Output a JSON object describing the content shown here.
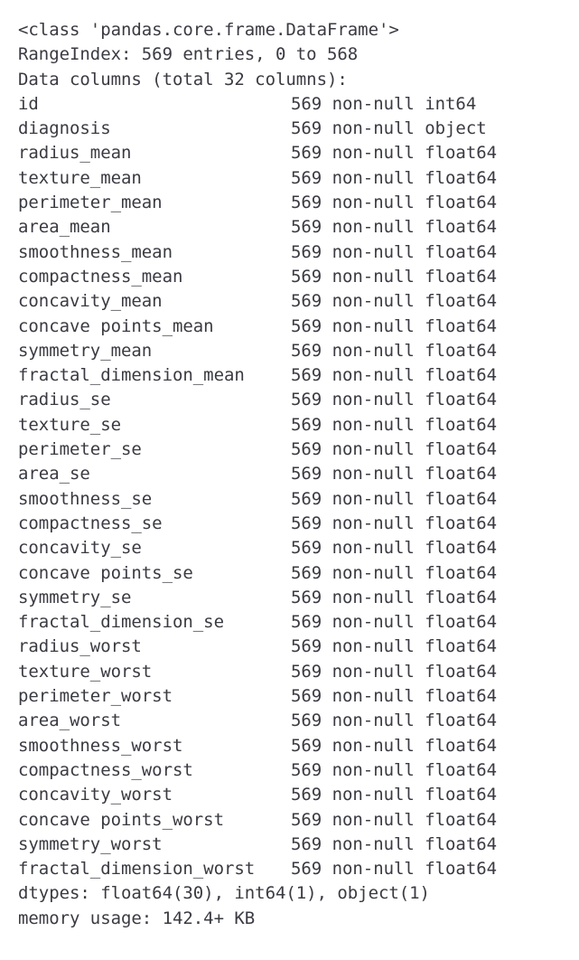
{
  "header": {
    "class_line": "<class 'pandas.core.frame.DataFrame'>",
    "index_line": "RangeIndex: 569 entries, 0 to 568",
    "columns_line": "Data columns (total 32 columns):"
  },
  "columns": [
    {
      "name": "id",
      "count": "569",
      "nonnull": "non-null",
      "dtype": "int64"
    },
    {
      "name": "diagnosis",
      "count": "569",
      "nonnull": "non-null",
      "dtype": "object"
    },
    {
      "name": "radius_mean",
      "count": "569",
      "nonnull": "non-null",
      "dtype": "float64"
    },
    {
      "name": "texture_mean",
      "count": "569",
      "nonnull": "non-null",
      "dtype": "float64"
    },
    {
      "name": "perimeter_mean",
      "count": "569",
      "nonnull": "non-null",
      "dtype": "float64"
    },
    {
      "name": "area_mean",
      "count": "569",
      "nonnull": "non-null",
      "dtype": "float64"
    },
    {
      "name": "smoothness_mean",
      "count": "569",
      "nonnull": "non-null",
      "dtype": "float64"
    },
    {
      "name": "compactness_mean",
      "count": "569",
      "nonnull": "non-null",
      "dtype": "float64"
    },
    {
      "name": "concavity_mean",
      "count": "569",
      "nonnull": "non-null",
      "dtype": "float64"
    },
    {
      "name": "concave points_mean",
      "count": "569",
      "nonnull": "non-null",
      "dtype": "float64"
    },
    {
      "name": "symmetry_mean",
      "count": "569",
      "nonnull": "non-null",
      "dtype": "float64"
    },
    {
      "name": "fractal_dimension_mean",
      "count": "569",
      "nonnull": "non-null",
      "dtype": "float64"
    },
    {
      "name": "radius_se",
      "count": "569",
      "nonnull": "non-null",
      "dtype": "float64"
    },
    {
      "name": "texture_se",
      "count": "569",
      "nonnull": "non-null",
      "dtype": "float64"
    },
    {
      "name": "perimeter_se",
      "count": "569",
      "nonnull": "non-null",
      "dtype": "float64"
    },
    {
      "name": "area_se",
      "count": "569",
      "nonnull": "non-null",
      "dtype": "float64"
    },
    {
      "name": "smoothness_se",
      "count": "569",
      "nonnull": "non-null",
      "dtype": "float64"
    },
    {
      "name": "compactness_se",
      "count": "569",
      "nonnull": "non-null",
      "dtype": "float64"
    },
    {
      "name": "concavity_se",
      "count": "569",
      "nonnull": "non-null",
      "dtype": "float64"
    },
    {
      "name": "concave points_se",
      "count": "569",
      "nonnull": "non-null",
      "dtype": "float64"
    },
    {
      "name": "symmetry_se",
      "count": "569",
      "nonnull": "non-null",
      "dtype": "float64"
    },
    {
      "name": "fractal_dimension_se",
      "count": "569",
      "nonnull": "non-null",
      "dtype": "float64"
    },
    {
      "name": "radius_worst",
      "count": "569",
      "nonnull": "non-null",
      "dtype": "float64"
    },
    {
      "name": "texture_worst",
      "count": "569",
      "nonnull": "non-null",
      "dtype": "float64"
    },
    {
      "name": "perimeter_worst",
      "count": "569",
      "nonnull": "non-null",
      "dtype": "float64"
    },
    {
      "name": "area_worst",
      "count": "569",
      "nonnull": "non-null",
      "dtype": "float64"
    },
    {
      "name": "smoothness_worst",
      "count": "569",
      "nonnull": "non-null",
      "dtype": "float64"
    },
    {
      "name": "compactness_worst",
      "count": "569",
      "nonnull": "non-null",
      "dtype": "float64"
    },
    {
      "name": "concavity_worst",
      "count": "569",
      "nonnull": "non-null",
      "dtype": "float64"
    },
    {
      "name": "concave points_worst",
      "count": "569",
      "nonnull": "non-null",
      "dtype": "float64"
    },
    {
      "name": "symmetry_worst",
      "count": "569",
      "nonnull": "non-null",
      "dtype": "float64"
    },
    {
      "name": "fractal_dimension_worst",
      "count": "569",
      "nonnull": "non-null",
      "dtype": "float64"
    }
  ],
  "footer": {
    "dtypes_line": "dtypes: float64(30), int64(1), object(1)",
    "memory_line": "memory usage: 142.4+ KB"
  },
  "style": {
    "text_color": "#3a3a42",
    "background_color": "#ffffff"
  }
}
